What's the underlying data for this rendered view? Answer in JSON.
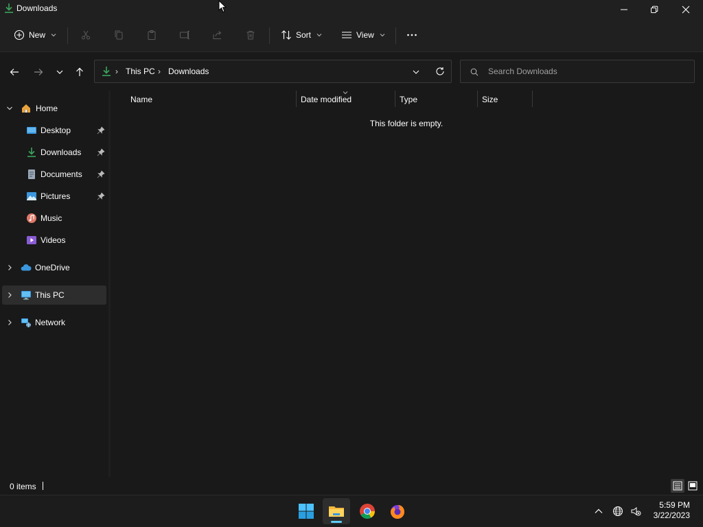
{
  "window": {
    "title": "Downloads",
    "icon": "download-icon"
  },
  "commandbar": {
    "new_label": "New",
    "sort_label": "Sort",
    "view_label": "View",
    "more_label": "···"
  },
  "address": {
    "crumbs": [
      "This PC",
      "Downloads"
    ],
    "separator": "›"
  },
  "search": {
    "placeholder": "Search Downloads"
  },
  "sidebar": {
    "home": "Home",
    "quick_access": [
      {
        "label": "Desktop",
        "icon": "desktop-icon",
        "pinned": true
      },
      {
        "label": "Downloads",
        "icon": "download-icon",
        "pinned": true
      },
      {
        "label": "Documents",
        "icon": "document-icon",
        "pinned": true
      },
      {
        "label": "Pictures",
        "icon": "pictures-icon",
        "pinned": true
      },
      {
        "label": "Music",
        "icon": "music-icon",
        "pinned": false
      },
      {
        "label": "Videos",
        "icon": "videos-icon",
        "pinned": false
      }
    ],
    "onedrive": "OneDrive",
    "this_pc": "This PC",
    "network": "Network",
    "selected": "This PC"
  },
  "columns": [
    "Name",
    "Date modified",
    "Type",
    "Size"
  ],
  "content": {
    "empty_message": "This folder is empty."
  },
  "status": {
    "item_count": "0 items",
    "active_view": "details"
  },
  "taskbar": {
    "apps": [
      "windows-start-icon",
      "file-explorer-icon",
      "chrome-icon",
      "firefox-icon"
    ],
    "active_app": "file-explorer-icon",
    "time": "5:59 PM",
    "date": "3/22/2023"
  },
  "colors": {
    "accent": "#60cdff",
    "download_green": "#3ba55d",
    "background": "#191919",
    "chrome": "#202020"
  }
}
